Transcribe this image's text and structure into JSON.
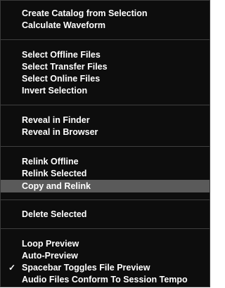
{
  "menu": {
    "create_catalog": "Create Catalog from Selection",
    "calculate_waveform": "Calculate Waveform",
    "select_offline": "Select Offline Files",
    "select_transfer": "Select Transfer Files",
    "select_online": "Select Online Files",
    "invert_selection": "Invert Selection",
    "reveal_finder": "Reveal in Finder",
    "reveal_browser": "Reveal in Browser",
    "relink_offline": "Relink Offline",
    "relink_selected": "Relink Selected",
    "copy_and_relink": "Copy and Relink",
    "delete_selected": "Delete Selected",
    "loop_preview": "Loop Preview",
    "auto_preview": "Auto-Preview",
    "spacebar_toggles": "Spacebar Toggles File Preview",
    "audio_conform": "Audio Files Conform To Session Tempo",
    "checkmark": "✓",
    "highlighted_item": "Copy and Relink",
    "checked_item": "Spacebar Toggles File Preview"
  },
  "colors": {
    "menu_background": "#0d0d0d",
    "highlight": "#5a5a5a",
    "separator": "#3f3f3f",
    "text": "#ffffff"
  }
}
